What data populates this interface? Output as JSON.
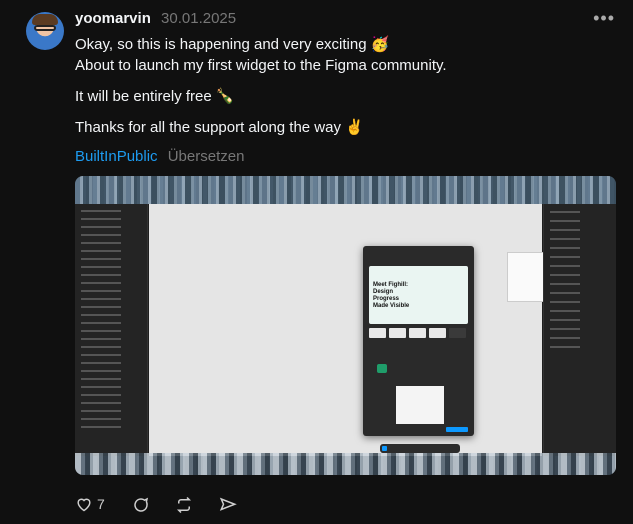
{
  "post": {
    "username": "yoomarvin",
    "date": "30.01.2025",
    "lines": [
      "Okay, so this is happening and very exciting 🥳",
      "About to launch my first widget to the Figma community.",
      "It will be entirely free 🍾",
      "Thanks for all the support along the way ✌️"
    ],
    "tag": "BuiltInPublic",
    "translate_label": "Übersetzen",
    "image_alt_text": {
      "plugin_title": "Meet Fighill: Design Progress Made Visible"
    }
  },
  "actions": {
    "like_count": "7"
  },
  "icons": {
    "more": "more-horizontal-icon",
    "like": "heart-icon",
    "reply": "comment-icon",
    "repost": "repost-icon",
    "share": "send-icon"
  },
  "colors": {
    "background": "#101010",
    "text": "#f3f5f7",
    "muted": "#777777",
    "link": "#1d9bf0"
  }
}
